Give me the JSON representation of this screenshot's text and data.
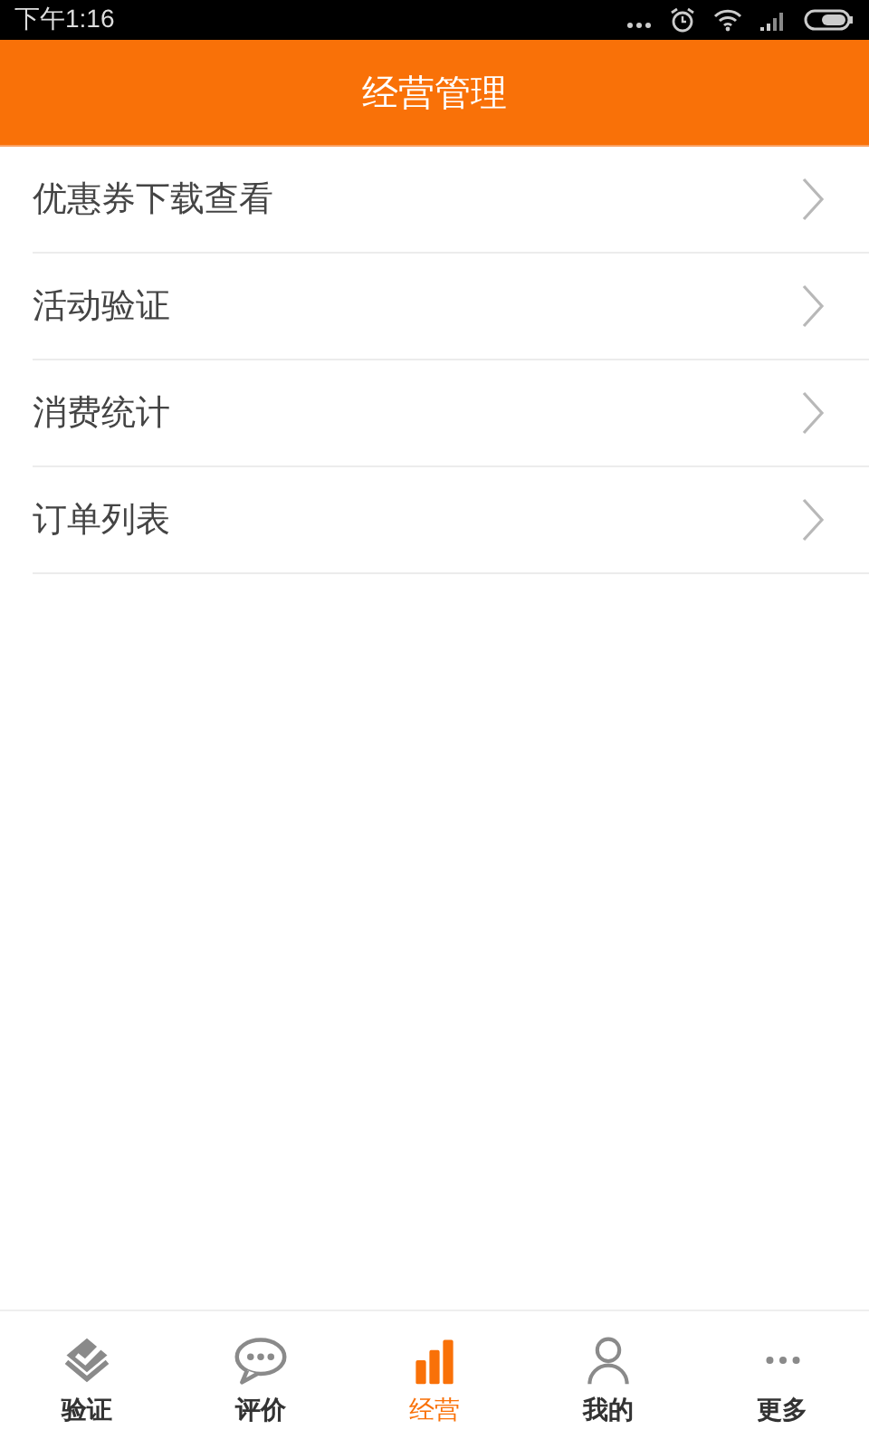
{
  "status_bar": {
    "time": "下午1:16",
    "icons": [
      {
        "kind": "dots"
      },
      {
        "kind": "alarm"
      },
      {
        "kind": "wifi"
      },
      {
        "kind": "signal"
      },
      {
        "kind": "battery"
      }
    ]
  },
  "header": {
    "title": "经营管理"
  },
  "menu": [
    {
      "label": "优惠券下载查看"
    },
    {
      "label": "活动验证"
    },
    {
      "label": "消费统计"
    },
    {
      "label": "订单列表"
    }
  ],
  "tabs": [
    {
      "label": "验证",
      "kind": "verify",
      "selected": false
    },
    {
      "label": "评价",
      "kind": "comment",
      "selected": false
    },
    {
      "label": "经营",
      "kind": "chart",
      "selected": true
    },
    {
      "label": "我的",
      "kind": "person",
      "selected": false
    },
    {
      "label": "更多",
      "kind": "more",
      "selected": false
    }
  ]
}
